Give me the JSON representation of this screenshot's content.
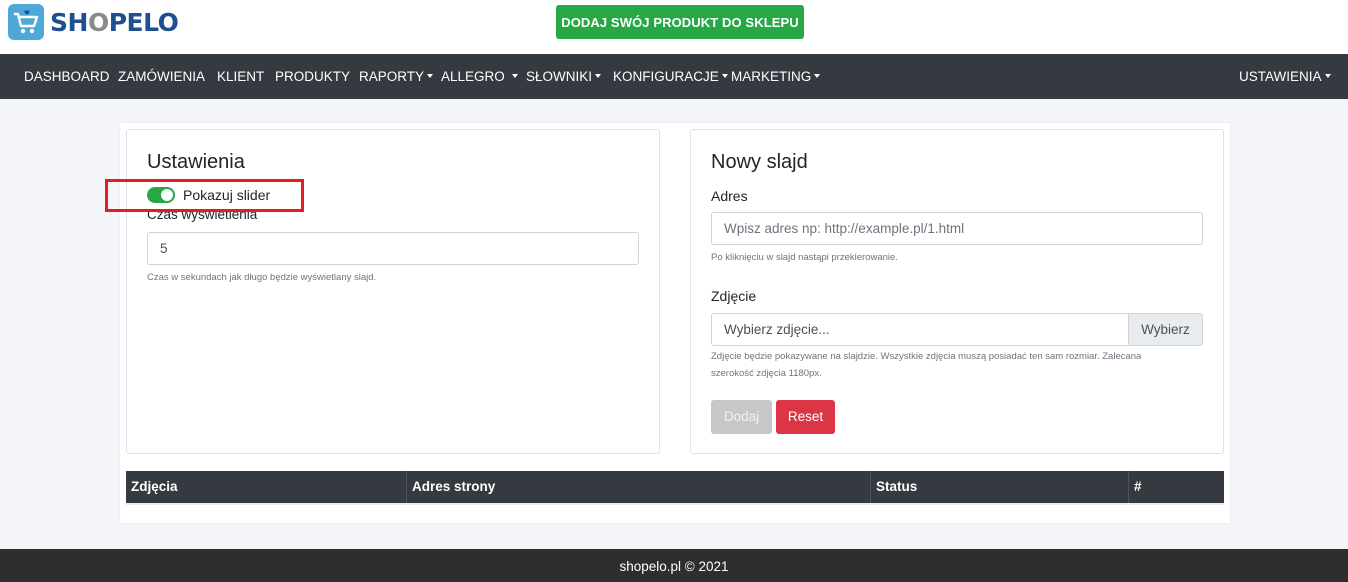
{
  "brand": {
    "name_part1": "SH",
    "name_part2": "O",
    "name_part3": "PELO",
    "logo_color": "#4ea8d8",
    "text_color": "#1f4f8f"
  },
  "header": {
    "cta_label": "DODAJ SWÓJ PRODUKT DO SKLEPU",
    "cta_color": "#28a745"
  },
  "nav": {
    "items": [
      {
        "label": "DASHBOARD",
        "dropdown": false
      },
      {
        "label": "ZAMÓWIENIA",
        "dropdown": false
      },
      {
        "label": "KLIENT",
        "dropdown": false
      },
      {
        "label": "PRODUKTY",
        "dropdown": false
      },
      {
        "label": "RAPORTY",
        "dropdown": true
      },
      {
        "label": "ALLEGRO",
        "dropdown": true
      },
      {
        "label": "SŁOWNIKI",
        "dropdown": true
      },
      {
        "label": "KONFIGURACJE",
        "dropdown": true
      },
      {
        "label": "MARKETING",
        "dropdown": true
      }
    ],
    "settings": {
      "label": "USTAWIENIA",
      "dropdown": true
    }
  },
  "settings_card": {
    "title": "Ustawienia",
    "toggle_label": "Pokazuj slider",
    "toggle_on": true,
    "duration_label": "Czas wyświetlenia",
    "duration_value": "5",
    "duration_help": "Czas w sekundach jak długo będzie wyświetlany slajd."
  },
  "new_slide_card": {
    "title": "Nowy slajd",
    "address_label": "Adres",
    "address_placeholder": "Wpisz adres np: http://example.pl/1.html",
    "address_help": "Po kliknięciu w slajd nastąpi przekierowanie.",
    "image_label": "Zdjęcie",
    "image_placeholder": "Wybierz zdjęcie...",
    "image_browse": "Wybierz",
    "image_help_line1": "Zdjęcie będzie pokazywane na slajdzie. Wszystkie zdjęcia muszą posiadać ten sam rozmiar. Zalecana",
    "image_help_line2": "szerokość zdjęcia 1180px.",
    "add_button": "Dodaj",
    "reset_button": "Reset"
  },
  "table": {
    "columns": [
      "Zdjęcia",
      "Adres strony",
      "Status",
      "#"
    ],
    "rows": []
  },
  "footer": {
    "text": "shopelo.pl © 2021"
  }
}
